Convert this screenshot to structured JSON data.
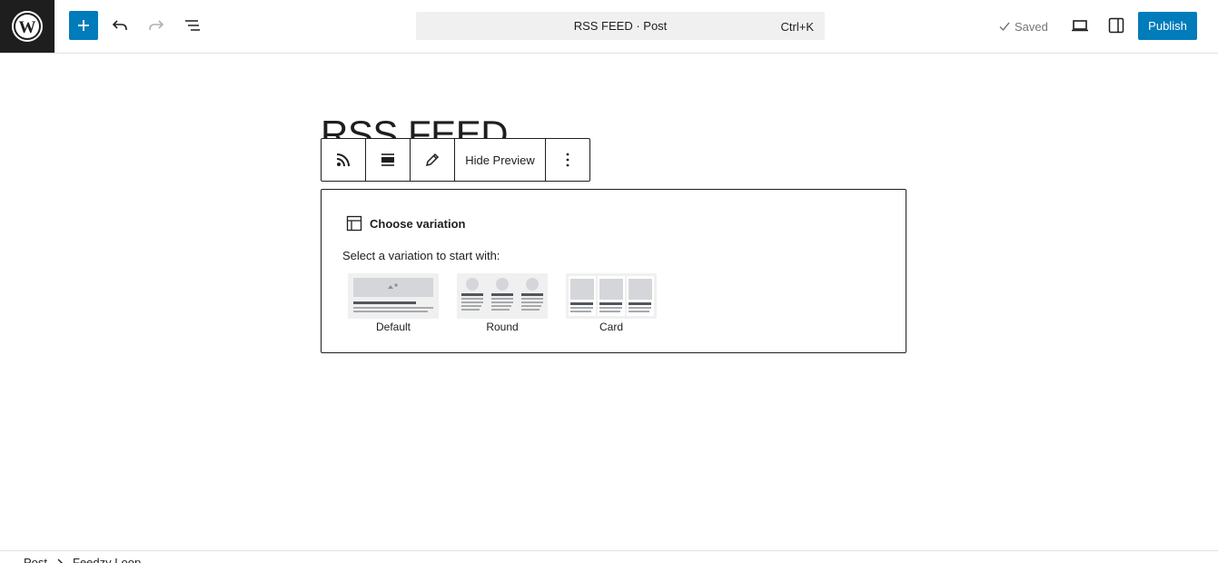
{
  "header": {
    "command_title": "RSS FEED · Post",
    "command_shortcut": "Ctrl+K",
    "saved_label": "Saved",
    "publish_label": "Publish",
    "accent_color": "#007cba",
    "icons": [
      "wordpress-logo",
      "plus-icon",
      "undo-icon",
      "redo-icon",
      "list-view-icon",
      "check-icon",
      "desktop-preview-icon",
      "sidebar-toggle-icon"
    ]
  },
  "post": {
    "title": "RSS FEED"
  },
  "block_toolbar": {
    "hide_preview_label": "Hide Preview",
    "icons": [
      "rss-icon",
      "align-icon",
      "pencil-icon",
      "more-vertical-icon"
    ]
  },
  "placeholder": {
    "heading": "Choose variation",
    "instructions": "Select a variation to start with:",
    "variations": [
      {
        "label": "Default"
      },
      {
        "label": "Round"
      },
      {
        "label": "Card"
      }
    ]
  },
  "breadcrumb": {
    "items": [
      "Post",
      "Feedzy Loop"
    ]
  }
}
